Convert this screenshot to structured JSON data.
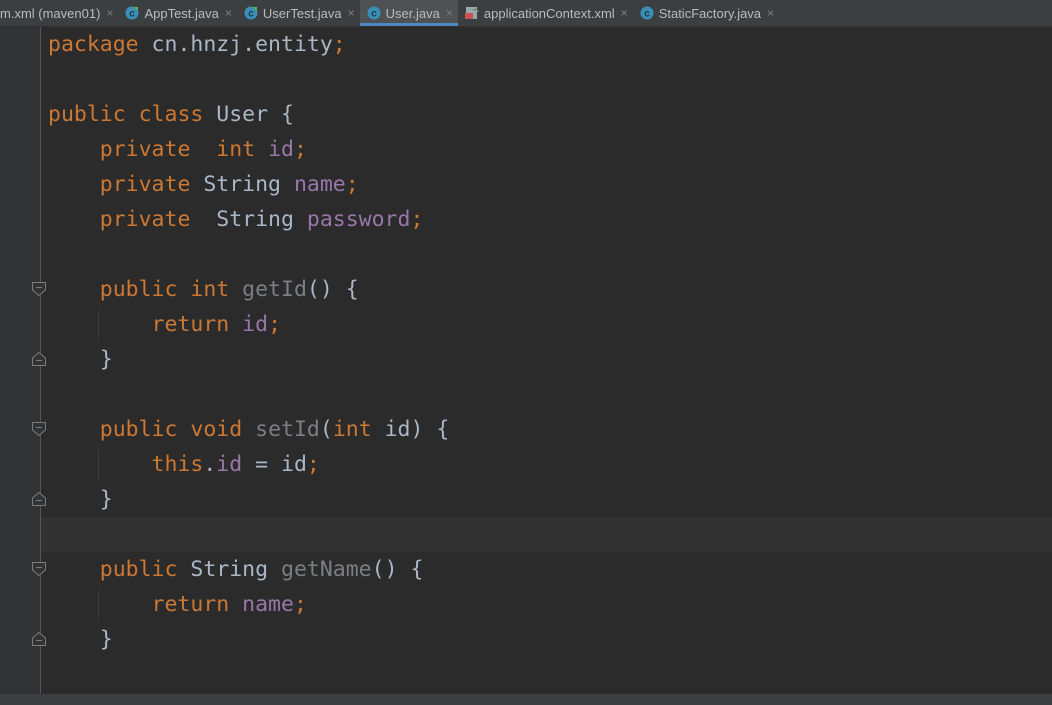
{
  "tabs": [
    {
      "label": "m.xml (maven01)",
      "icon": "none",
      "active": false
    },
    {
      "label": "AppTest.java",
      "icon": "java-test-class-icon",
      "active": false
    },
    {
      "label": "UserTest.java",
      "icon": "java-test-class-icon",
      "active": false
    },
    {
      "label": "User.java",
      "icon": "java-class-icon",
      "active": true
    },
    {
      "label": "applicationContext.xml",
      "icon": "spring-xml-icon",
      "active": false
    },
    {
      "label": "StaticFactory.java",
      "icon": "java-class-icon",
      "active": false
    }
  ],
  "tab_close_glyph": "×",
  "colors": {
    "keyword": "#cc7832",
    "field": "#9876aa",
    "method": "#7a7e85",
    "plain": "#a9b7c6",
    "background": "#2b2b2b",
    "active_tab_accent": "#4a88c7"
  },
  "code_lines": [
    [
      {
        "t": "package",
        "c": "kw"
      },
      {
        "t": " cn.hnzj.entity",
        "c": "txt"
      },
      {
        "t": ";",
        "c": "kw"
      }
    ],
    [],
    [
      {
        "t": "public class",
        "c": "kw"
      },
      {
        "t": " User {",
        "c": "txt"
      }
    ],
    [
      {
        "t": "    private  int",
        "c": "kw"
      },
      {
        "t": " ",
        "c": "txt"
      },
      {
        "t": "id",
        "c": "fld"
      },
      {
        "t": ";",
        "c": "kw"
      }
    ],
    [
      {
        "t": "    private",
        "c": "kw"
      },
      {
        "t": " String ",
        "c": "txt"
      },
      {
        "t": "name",
        "c": "fld"
      },
      {
        "t": ";",
        "c": "kw"
      }
    ],
    [
      {
        "t": "    private",
        "c": "kw"
      },
      {
        "t": "  String ",
        "c": "txt"
      },
      {
        "t": "password",
        "c": "fld"
      },
      {
        "t": ";",
        "c": "kw"
      }
    ],
    [],
    [
      {
        "t": "    public int",
        "c": "kw"
      },
      {
        "t": " ",
        "c": "txt"
      },
      {
        "t": "getId",
        "c": "mth"
      },
      {
        "t": "() {",
        "c": "txt"
      }
    ],
    [
      {
        "t": "        return",
        "c": "kw"
      },
      {
        "t": " ",
        "c": "txt"
      },
      {
        "t": "id",
        "c": "fld"
      },
      {
        "t": ";",
        "c": "kw"
      }
    ],
    [
      {
        "t": "    }",
        "c": "txt"
      }
    ],
    [],
    [
      {
        "t": "    public void",
        "c": "kw"
      },
      {
        "t": " ",
        "c": "txt"
      },
      {
        "t": "setId",
        "c": "mth"
      },
      {
        "t": "(",
        "c": "txt"
      },
      {
        "t": "int",
        "c": "kw"
      },
      {
        "t": " id) {",
        "c": "txt"
      }
    ],
    [
      {
        "t": "        this",
        "c": "kw"
      },
      {
        "t": ".",
        "c": "txt"
      },
      {
        "t": "id",
        "c": "fld"
      },
      {
        "t": " = id",
        "c": "txt"
      },
      {
        "t": ";",
        "c": "kw"
      }
    ],
    [
      {
        "t": "    }",
        "c": "txt"
      }
    ],
    [],
    [
      {
        "t": "    public",
        "c": "kw"
      },
      {
        "t": " String ",
        "c": "txt"
      },
      {
        "t": "getName",
        "c": "mth"
      },
      {
        "t": "() {",
        "c": "txt"
      }
    ],
    [
      {
        "t": "        return",
        "c": "kw"
      },
      {
        "t": " ",
        "c": "txt"
      },
      {
        "t": "name",
        "c": "fld"
      },
      {
        "t": ";",
        "c": "kw"
      }
    ],
    [
      {
        "t": "    }",
        "c": "txt"
      }
    ],
    []
  ],
  "fold_markers": [
    {
      "line": 7,
      "kind": "open"
    },
    {
      "line": 9,
      "kind": "close"
    },
    {
      "line": 11,
      "kind": "open"
    },
    {
      "line": 13,
      "kind": "close"
    },
    {
      "line": 15,
      "kind": "open"
    },
    {
      "line": 17,
      "kind": "close"
    }
  ],
  "current_line": 14
}
